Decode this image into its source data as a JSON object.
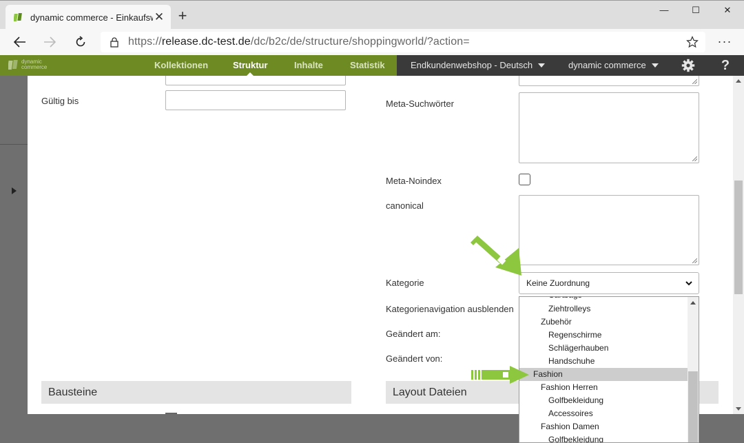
{
  "browser": {
    "tab_title": "dynamic commerce - Einkaufswe",
    "tab_close": "✕",
    "new_tab": "+",
    "url_prefix": "https://",
    "url_host": "release.dc-test.de",
    "url_path": "/dc/b2c/de/structure/shoppingworld/?action=",
    "more_menu": "···",
    "win_min": "—",
    "win_max": "☐",
    "win_close": "✕"
  },
  "app": {
    "logo_text_1": "dynamic",
    "logo_text_2": "commerce",
    "nav": [
      {
        "label": "Kollektionen"
      },
      {
        "label": "Struktur"
      },
      {
        "label": "Inhalte"
      },
      {
        "label": "Statistik"
      }
    ],
    "shop_select": "Endkundenwebshop - Deutsch",
    "company_select": "dynamic commerce",
    "help": "?"
  },
  "form": {
    "gueltig_bis": "Gültig bis",
    "meta_suchwoerter": "Meta-Suchwörter",
    "meta_noindex": "Meta-Noindex",
    "canonical": "canonical",
    "kategorie": "Kategorie",
    "kategorie_value": "Keine Zuordnung",
    "kategorienavigation": "Kategorienavigation ausblenden",
    "geaendert_am": "Geändert am:",
    "geaendert_von": "Geändert von:",
    "section_bausteine": "Bausteine",
    "section_layout": "Layout Dateien"
  },
  "dropdown": {
    "items": [
      {
        "label": "Cartbags",
        "indent": 2
      },
      {
        "label": "Ziehtrolleys",
        "indent": 2
      },
      {
        "label": "Zubehör",
        "indent": 1
      },
      {
        "label": "Regenschirme",
        "indent": 2
      },
      {
        "label": "Schlägerhauben",
        "indent": 2
      },
      {
        "label": "Handschuhe",
        "indent": 2
      },
      {
        "label": "Fashion",
        "indent": 0,
        "selected": true
      },
      {
        "label": "Fashion Herren",
        "indent": 1
      },
      {
        "label": "Golfbekleidung",
        "indent": 2
      },
      {
        "label": "Accessoires",
        "indent": 2
      },
      {
        "label": "Fashion Damen",
        "indent": 1
      },
      {
        "label": "Golfbekleidung",
        "indent": 2
      }
    ]
  },
  "colors": {
    "brand_green": "#6e8b23",
    "arrow_green": "#8dc63f",
    "header_dark": "#3a3a3a"
  }
}
